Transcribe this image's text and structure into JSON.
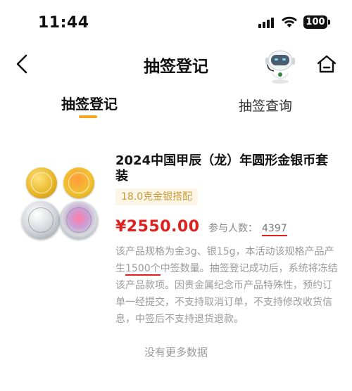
{
  "status_bar": {
    "time": "11:44",
    "battery": "100"
  },
  "nav": {
    "title": "抽签登记",
    "back_icon": "chevron-left",
    "assistant_icon": "robot-assistant",
    "home_icon": "home"
  },
  "tabs": [
    {
      "label": "抽签登记",
      "active": true
    },
    {
      "label": "抽签查询",
      "active": false
    }
  ],
  "colors": {
    "accent": "#f5a623",
    "price": "#e0201f",
    "tag_bg": "#fdf6e6",
    "tag_text": "#c99b3b"
  },
  "product": {
    "title": "2024中国甲辰（龙）年圆形金银币套装",
    "tag": "18.0克金银搭配",
    "price": "¥2550.00",
    "participants_label": "参与人数：",
    "participants_count": "4397",
    "description": {
      "part1": "该产品规格为金3g、银15g，本活动该规格产品产生",
      "quantity": "1500个",
      "part2": "中签数量。抽签登记成功后，系统将冻结该产品款项。因贵金属纪念币产品特殊性，预约订单一经提交，不支持取消订单，不支持修改收货信息，中签后不支持退货退款。"
    }
  },
  "footer": {
    "no_more": "没有更多数据"
  }
}
